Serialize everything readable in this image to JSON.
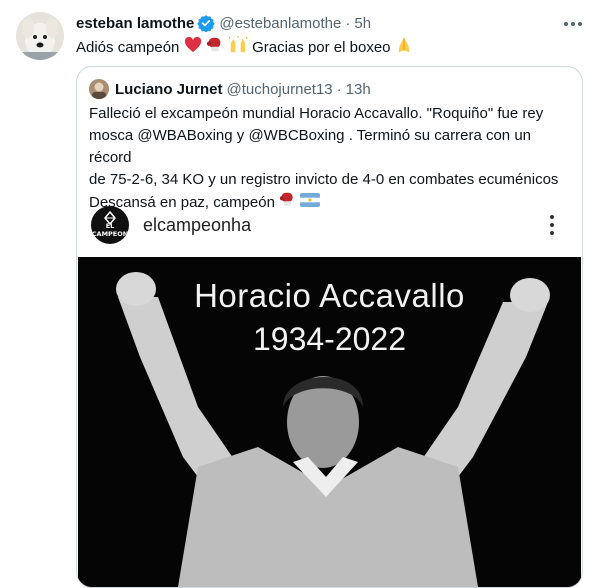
{
  "tweet": {
    "author_name": "esteban lamothe",
    "author_handle": "@estebanlamothe",
    "separator": "·",
    "time": "5h",
    "text_part1": "Adiós campeón",
    "text_part2": "Gracias  por el boxeo",
    "icons": [
      "red-heart-icon",
      "boxing-glove-icon",
      "raising-hands-icon",
      "folded-hands-icon"
    ]
  },
  "quote": {
    "author_name": "Luciano Jurnet",
    "author_handle": "@tuchojurnet13",
    "separator": "·",
    "time": "13h",
    "text_line1": "Falleció el excampeón mundial Horacio Accavallo. \"Roquiño\" fue rey",
    "text_line2": "mosca @WBABoxing y @WBCBoxing . Terminó su carrera con un récord",
    "text_line3": "de 75-2-6, 34 KO y un registro invicto de 4-0 en combates ecuménicos",
    "text_line4": "Descansá en paz, campeón"
  },
  "embedded_post": {
    "account_name": "elcampeonha",
    "avatar_text": "EL CAMPEON",
    "photo_title": "Horacio Accavallo",
    "photo_years": "1934-2022"
  },
  "colors": {
    "verified": "#1d9bf0",
    "muted": "#536471",
    "border": "#cfd9de"
  }
}
